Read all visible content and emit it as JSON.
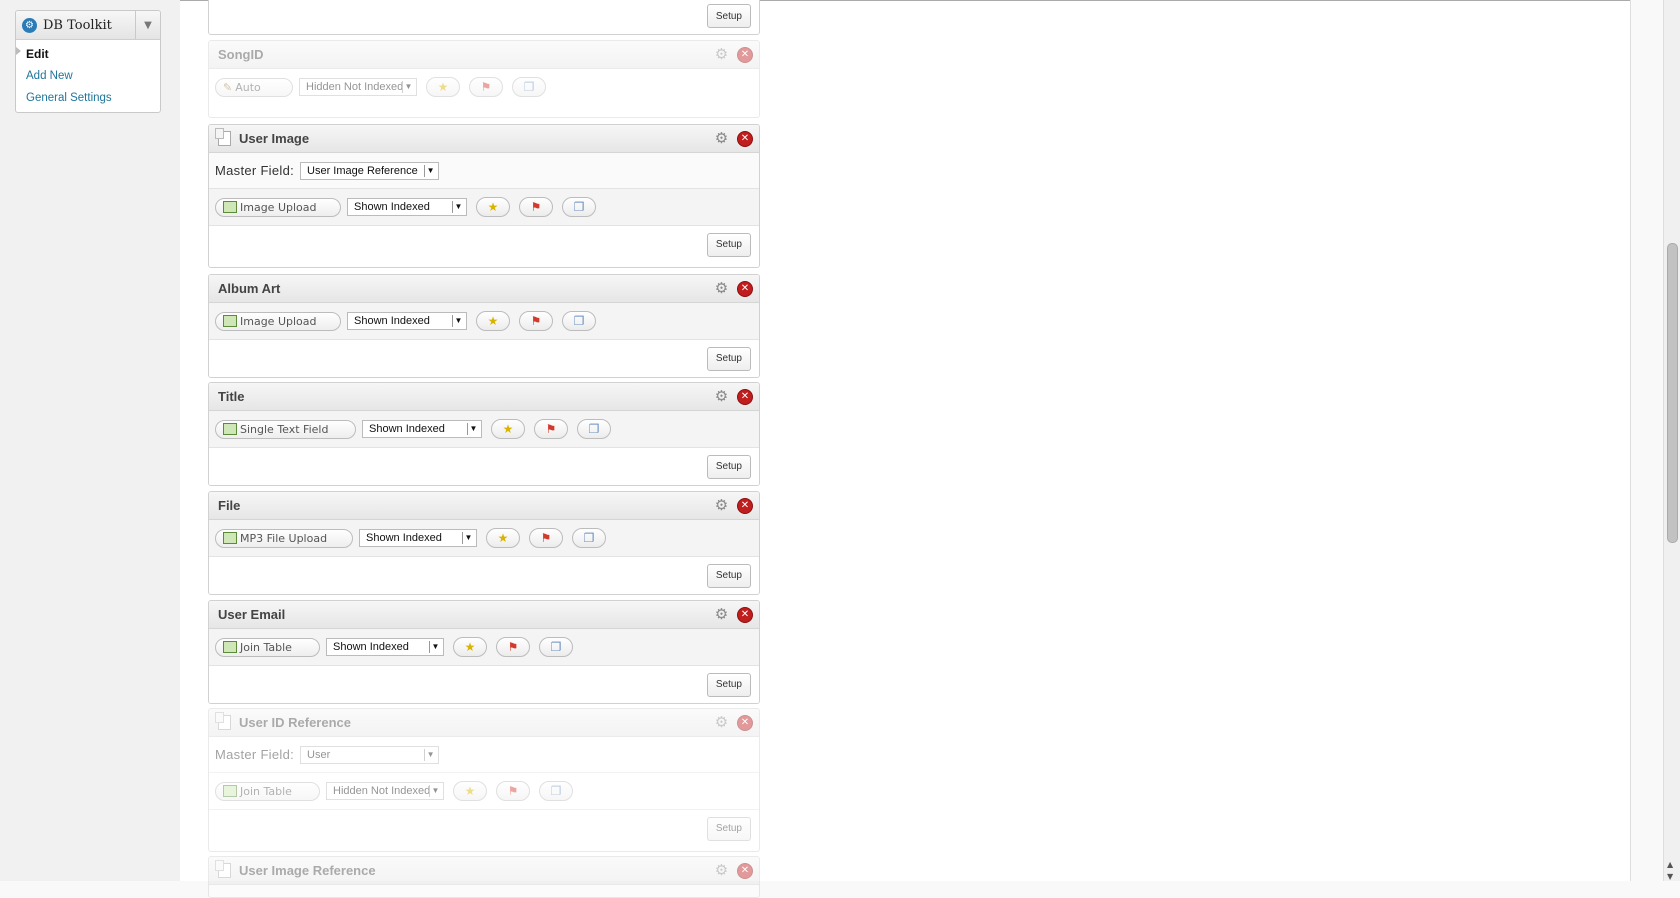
{
  "menu": {
    "title": "DB Toolkit",
    "items": [
      {
        "label": "Edit",
        "current": true
      },
      {
        "label": "Add New",
        "current": false
      },
      {
        "label": "General Settings",
        "current": false
      }
    ]
  },
  "setup_label": "Setup",
  "master_field_label": "Master Field:",
  "panels": [
    {
      "title": "SongID",
      "type": "Auto",
      "visibility": "Hidden Not Indexed",
      "disabled": true
    },
    {
      "title": "User Image",
      "master": "User Image Reference",
      "type": "Image Upload",
      "visibility": "Shown Indexed"
    },
    {
      "title": "Album Art",
      "type": "Image Upload",
      "visibility": "Shown Indexed"
    },
    {
      "title": "Title",
      "type": "Single Text Field",
      "visibility": "Shown Indexed"
    },
    {
      "title": "File",
      "type": "MP3 File Upload",
      "visibility": "Shown Indexed"
    },
    {
      "title": "User Email",
      "type": "Join Table",
      "visibility": "Shown Indexed"
    },
    {
      "title": "User ID Reference",
      "master": "User",
      "type": "Join Table",
      "visibility": "Hidden Not Indexed",
      "disabled": true
    },
    {
      "title": "User Image Reference",
      "disabled": true
    }
  ]
}
